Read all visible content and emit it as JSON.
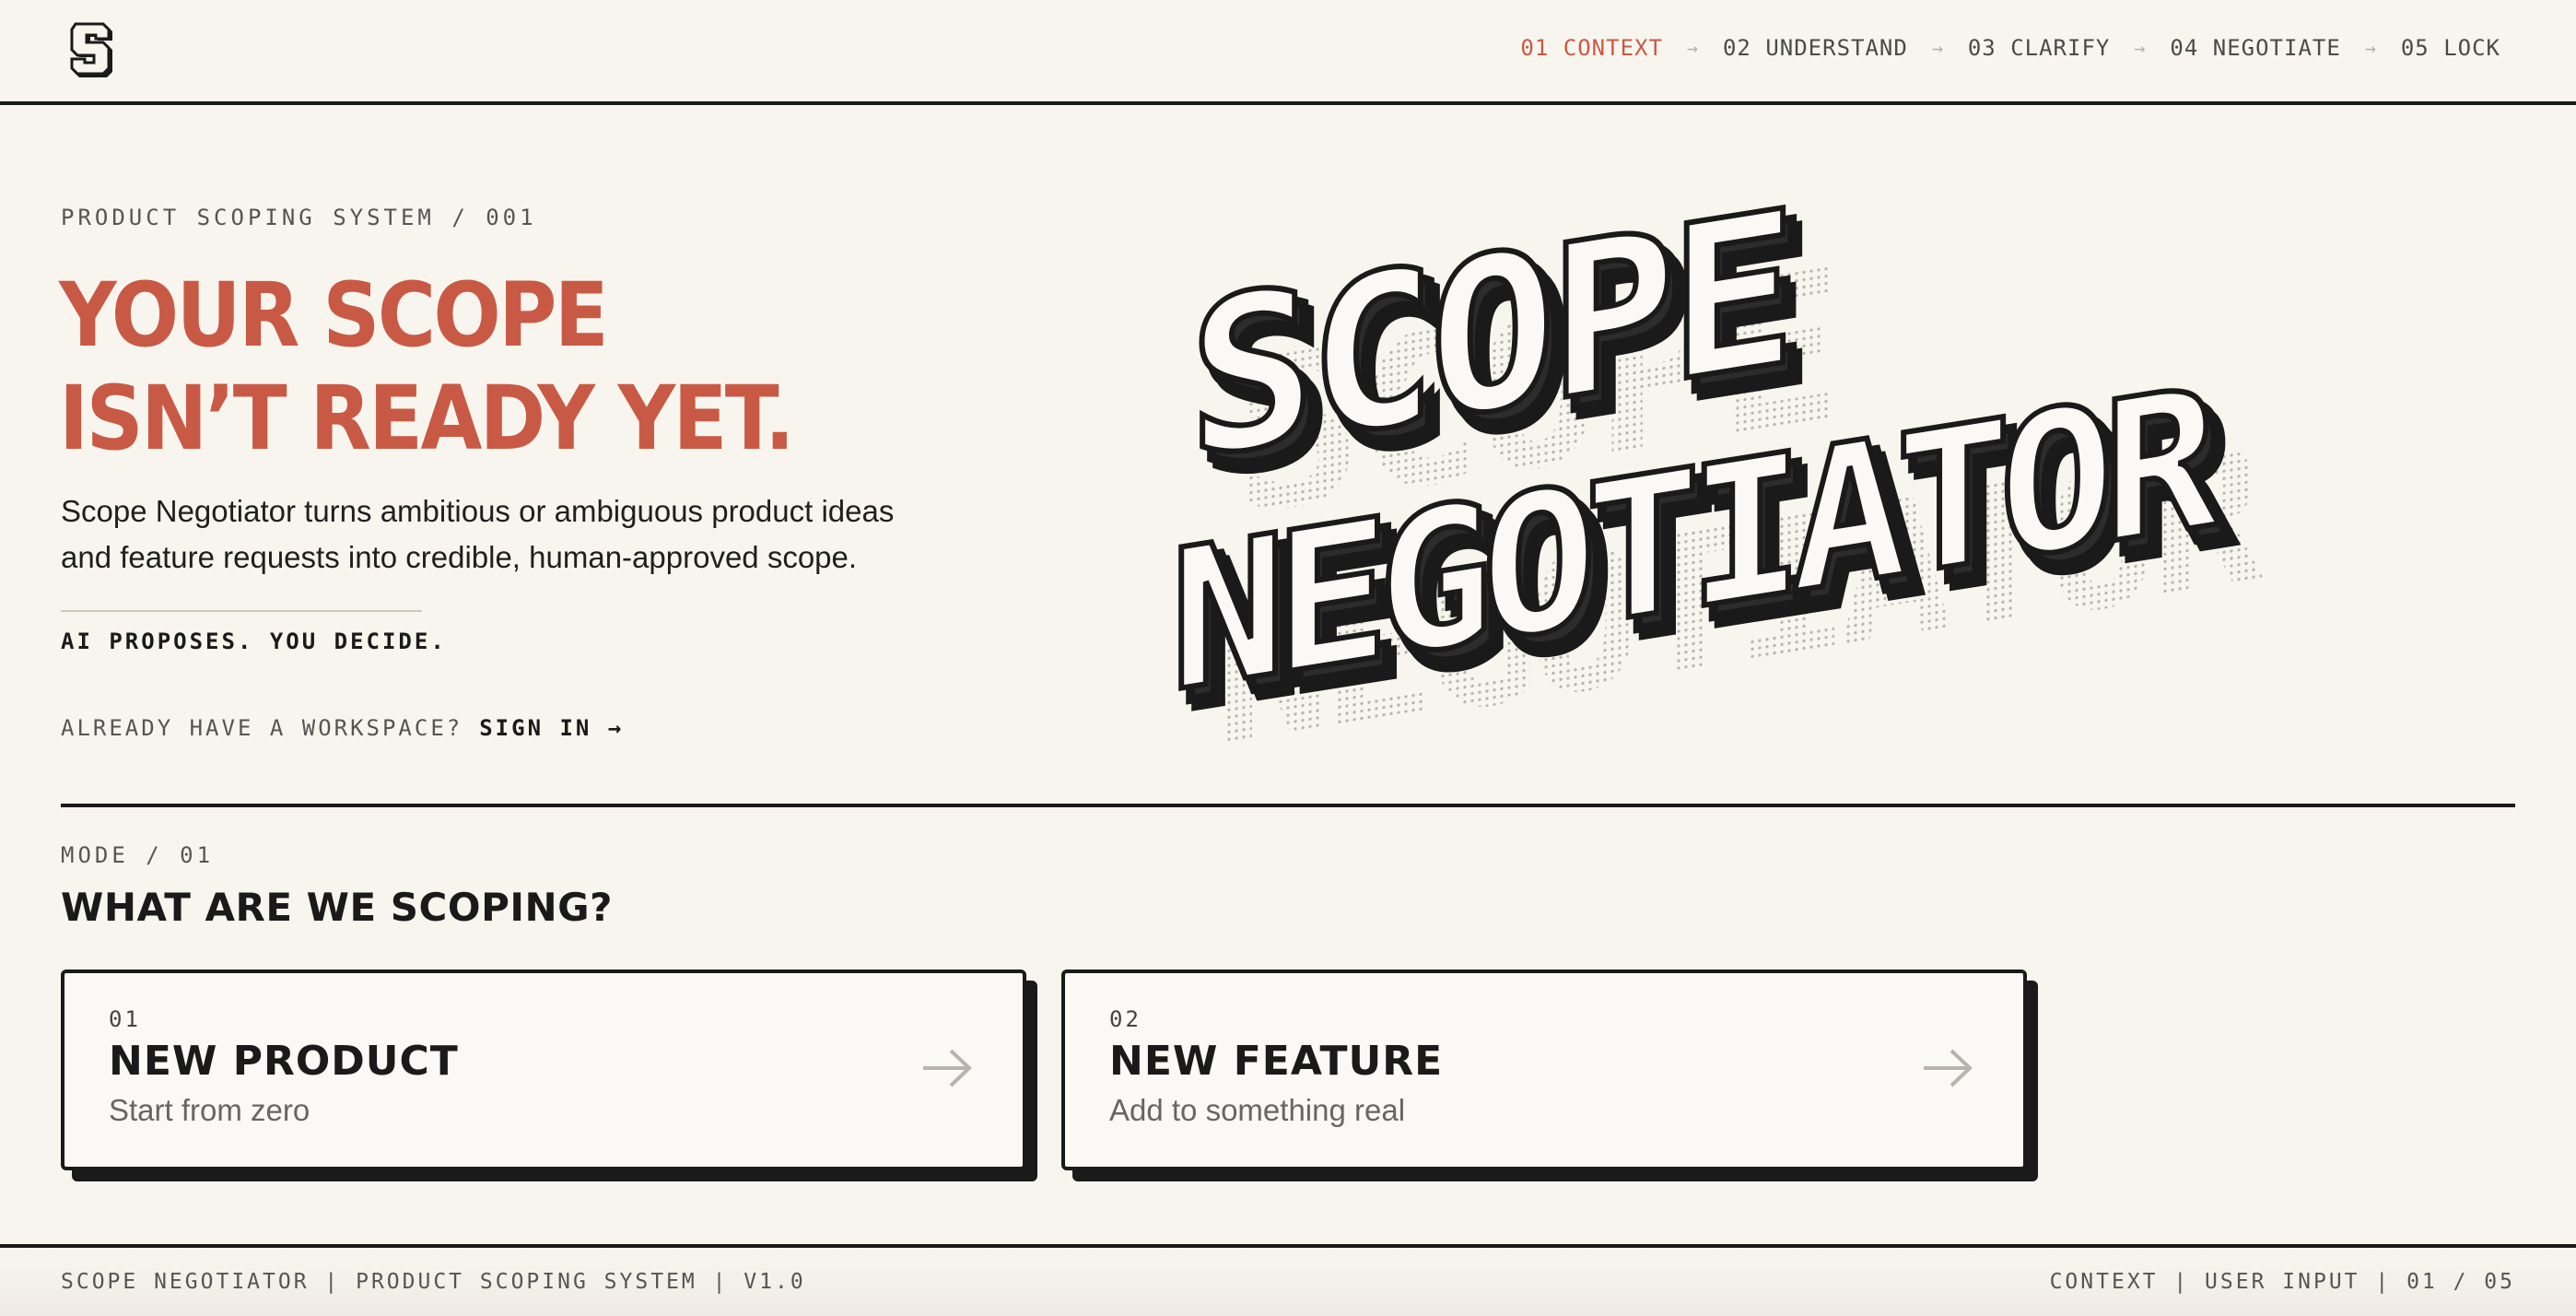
{
  "logo_mark": "S",
  "nav": {
    "steps": [
      {
        "label": "01 CONTEXT",
        "active": true
      },
      {
        "label": "02 UNDERSTAND",
        "active": false
      },
      {
        "label": "03 CLARIFY",
        "active": false
      },
      {
        "label": "04 NEGOTIATE",
        "active": false
      },
      {
        "label": "05 LOCK",
        "active": false
      }
    ],
    "separator": "→"
  },
  "hero": {
    "eyebrow": "PRODUCT SCOPING SYSTEM / 001",
    "headline_line1": "YOUR SCOPE",
    "headline_line2": "ISN’T READY YET.",
    "description_line1": "Scope Negotiator turns ambitious or ambiguous product ideas",
    "description_line2": "and feature requests into credible, human-approved scope.",
    "tagline": "AI PROPOSES. YOU DECIDE.",
    "signin_prompt": "ALREADY HAVE A WORKSPACE?",
    "signin_link": "SIGN IN →",
    "wordmark_line1": "SCOPE",
    "wordmark_line2": "NEGOTIATOR"
  },
  "mode": {
    "label": "MODE / 01",
    "title": "WHAT ARE WE SCOPING?",
    "options": [
      {
        "number": "01",
        "title": "NEW PRODUCT",
        "subtitle": "Start from zero"
      },
      {
        "number": "02",
        "title": "NEW FEATURE",
        "subtitle": "Add to something real"
      }
    ]
  },
  "footer": {
    "left": "SCOPE NEGOTIATOR | PRODUCT SCOPING SYSTEM | V1.0",
    "right": "CONTEXT | USER INPUT | 01 / 05"
  },
  "colors": {
    "background": "#f8f5ef",
    "accent": "#c85a45",
    "ink": "#1a1a1a"
  },
  "icons": [
    "logo-s-icon",
    "arrow-right-icon"
  ]
}
